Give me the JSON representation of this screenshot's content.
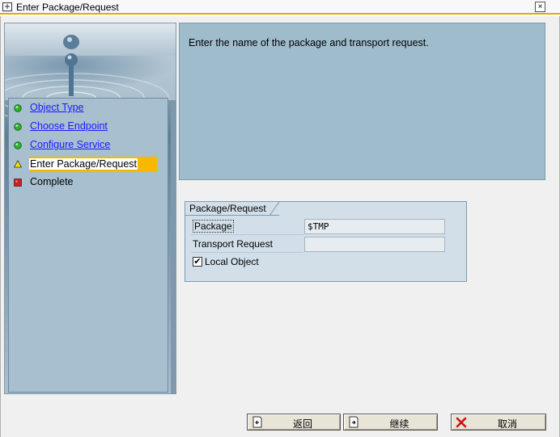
{
  "window": {
    "title": "Enter Package/Request",
    "close_glyph": "×"
  },
  "steps": [
    {
      "label": "Object Type",
      "status": "done",
      "status_color": "#2fb32f"
    },
    {
      "label": "Choose Endpoint",
      "status": "done",
      "status_color": "#2fb32f"
    },
    {
      "label": "Configure Service",
      "status": "done",
      "status_color": "#2fb32f"
    },
    {
      "label": "Enter Package/Request",
      "status": "current",
      "status_color": "#f8d800"
    },
    {
      "label": "Complete",
      "status": "pending",
      "status_color": "#cc1f1f"
    }
  ],
  "info": {
    "message": "Enter the name of the package and transport request."
  },
  "group": {
    "title": "Package/Request",
    "package_label": "Package",
    "package_value": "$TMP",
    "transport_label": "Transport Request",
    "transport_value": "",
    "local_object_label": "Local Object",
    "local_object_checked": true,
    "check_glyph": "✔"
  },
  "buttons": {
    "back_label": "返回",
    "continue_label": "继续",
    "cancel_label": "取消"
  },
  "colors": {
    "accent": "#f8b800",
    "panel_blue": "#9fbccd",
    "link": "#1a1aff"
  }
}
